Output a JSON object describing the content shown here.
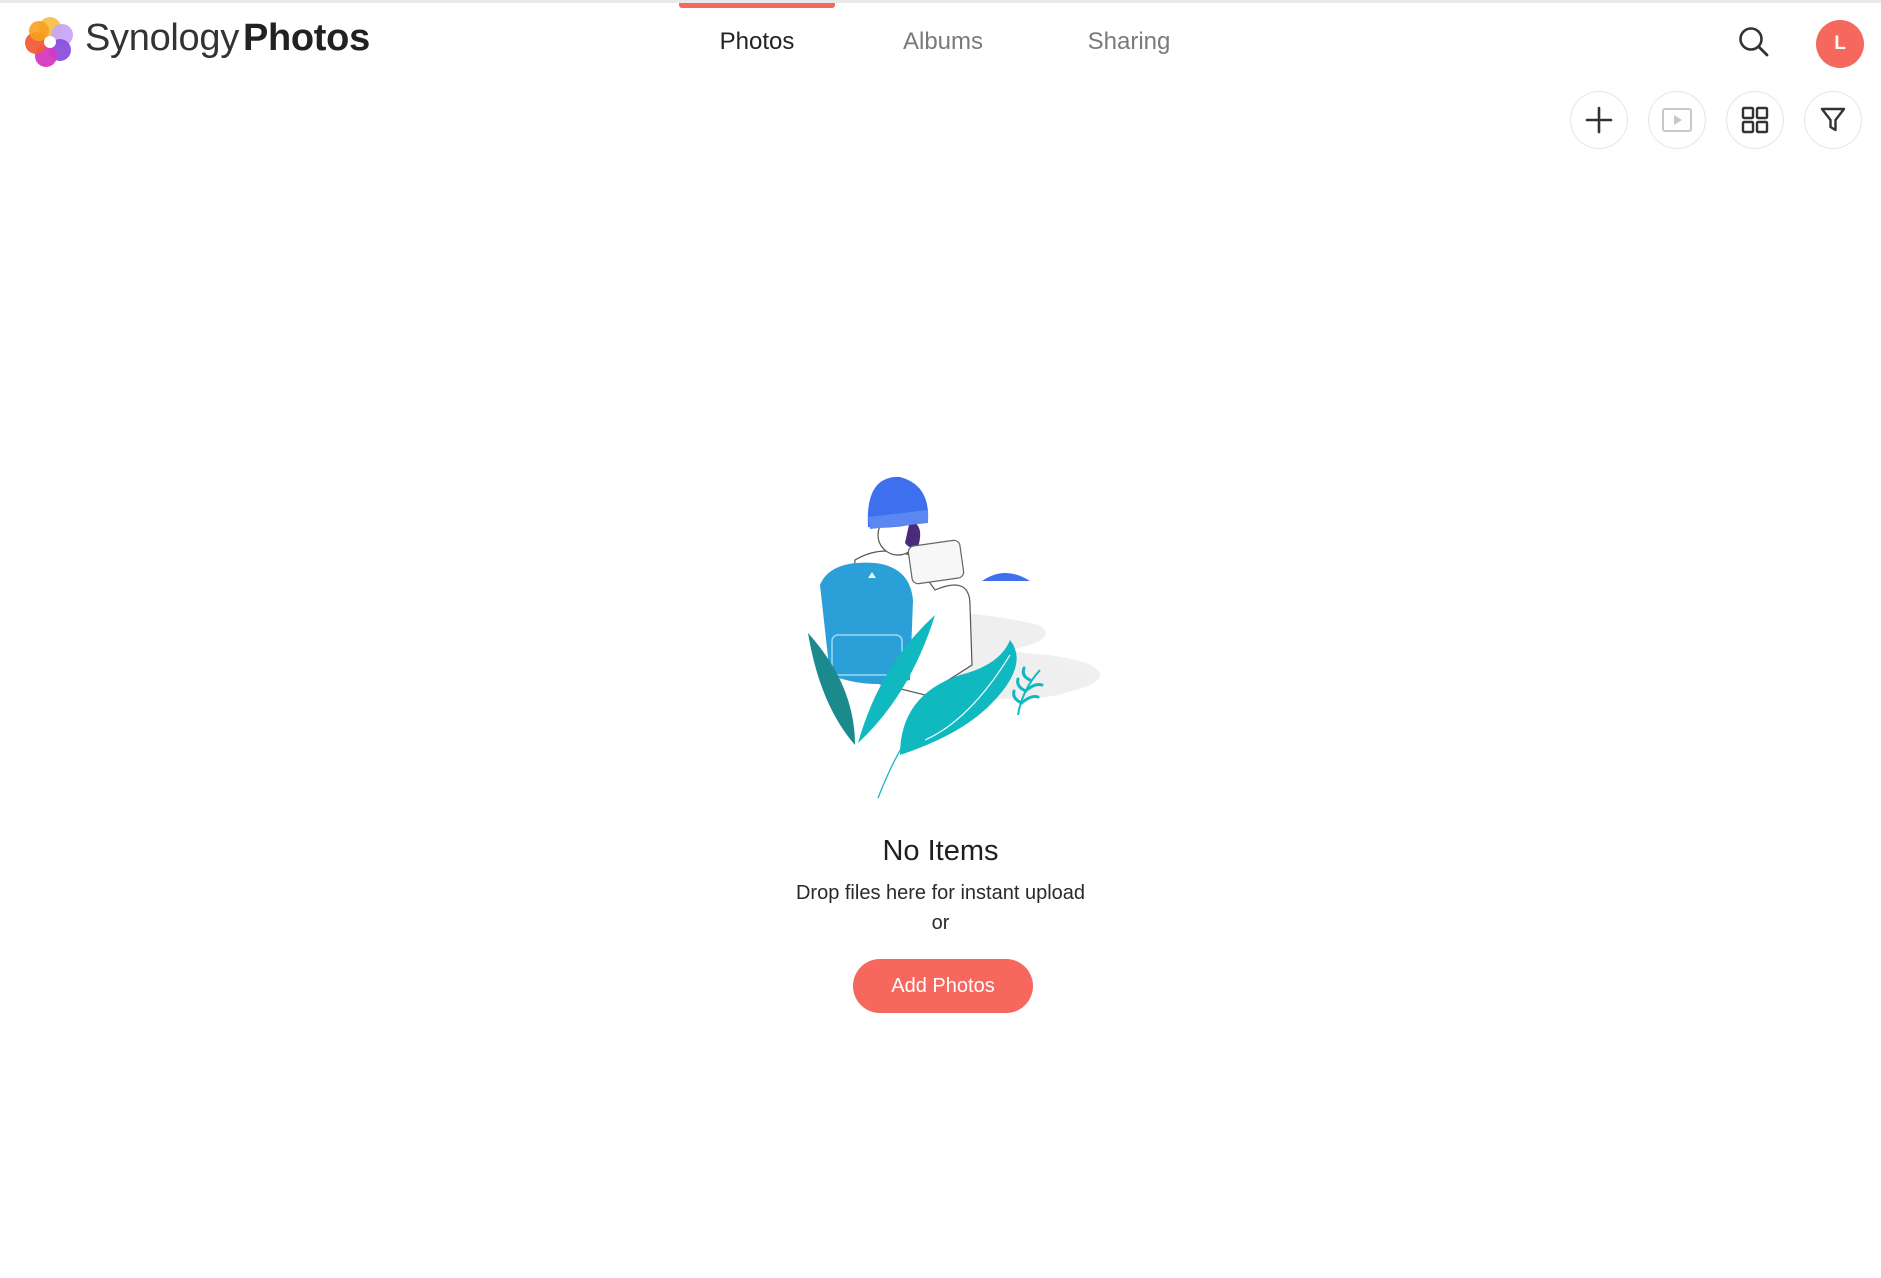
{
  "app": {
    "brand_light": "Synology",
    "brand_bold": "Photos",
    "accent_color": "#f6685e"
  },
  "nav": {
    "tabs": [
      {
        "label": "Photos",
        "active": true
      },
      {
        "label": "Albums",
        "active": false
      },
      {
        "label": "Sharing",
        "active": false
      }
    ]
  },
  "header": {
    "search_icon": "search-icon",
    "avatar_initial": "L"
  },
  "toolbar": {
    "buttons": [
      {
        "icon": "plus-icon"
      },
      {
        "icon": "slideshow-icon",
        "disabled": true
      },
      {
        "icon": "grid-view-icon"
      },
      {
        "icon": "filter-icon"
      }
    ]
  },
  "empty_state": {
    "title": "No Items",
    "subtitle": "Drop files here for instant upload",
    "or_text": "or",
    "button_label": "Add Photos"
  }
}
